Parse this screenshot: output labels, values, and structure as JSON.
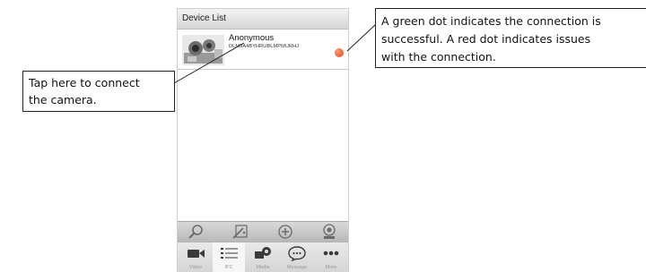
{
  "phone": {
    "title": "Device List",
    "device": {
      "name": "Anonymous",
      "id": "DLM9A4BYHRUBLMPMURHJ",
      "status_color": "#e24a1c"
    },
    "toolbar_icons": [
      "search-icon",
      "edit-icon",
      "add-icon",
      "camera-icon"
    ],
    "tabs": [
      {
        "label": "Video",
        "icon": "video-icon",
        "active": false
      },
      {
        "label": "IPC",
        "icon": "list-icon",
        "active": true
      },
      {
        "label": "Media",
        "icon": "media-icon",
        "active": false
      },
      {
        "label": "Message",
        "icon": "message-icon",
        "active": false
      },
      {
        "label": "More",
        "icon": "more-icon",
        "active": false
      }
    ]
  },
  "callouts": {
    "left_line1": "Tap here to connect",
    "left_line2": "the camera.",
    "right_line1": "A green dot indicates the connection is",
    "right_line2": "successful. A red dot indicates issues",
    "right_line3": "with the connection."
  }
}
